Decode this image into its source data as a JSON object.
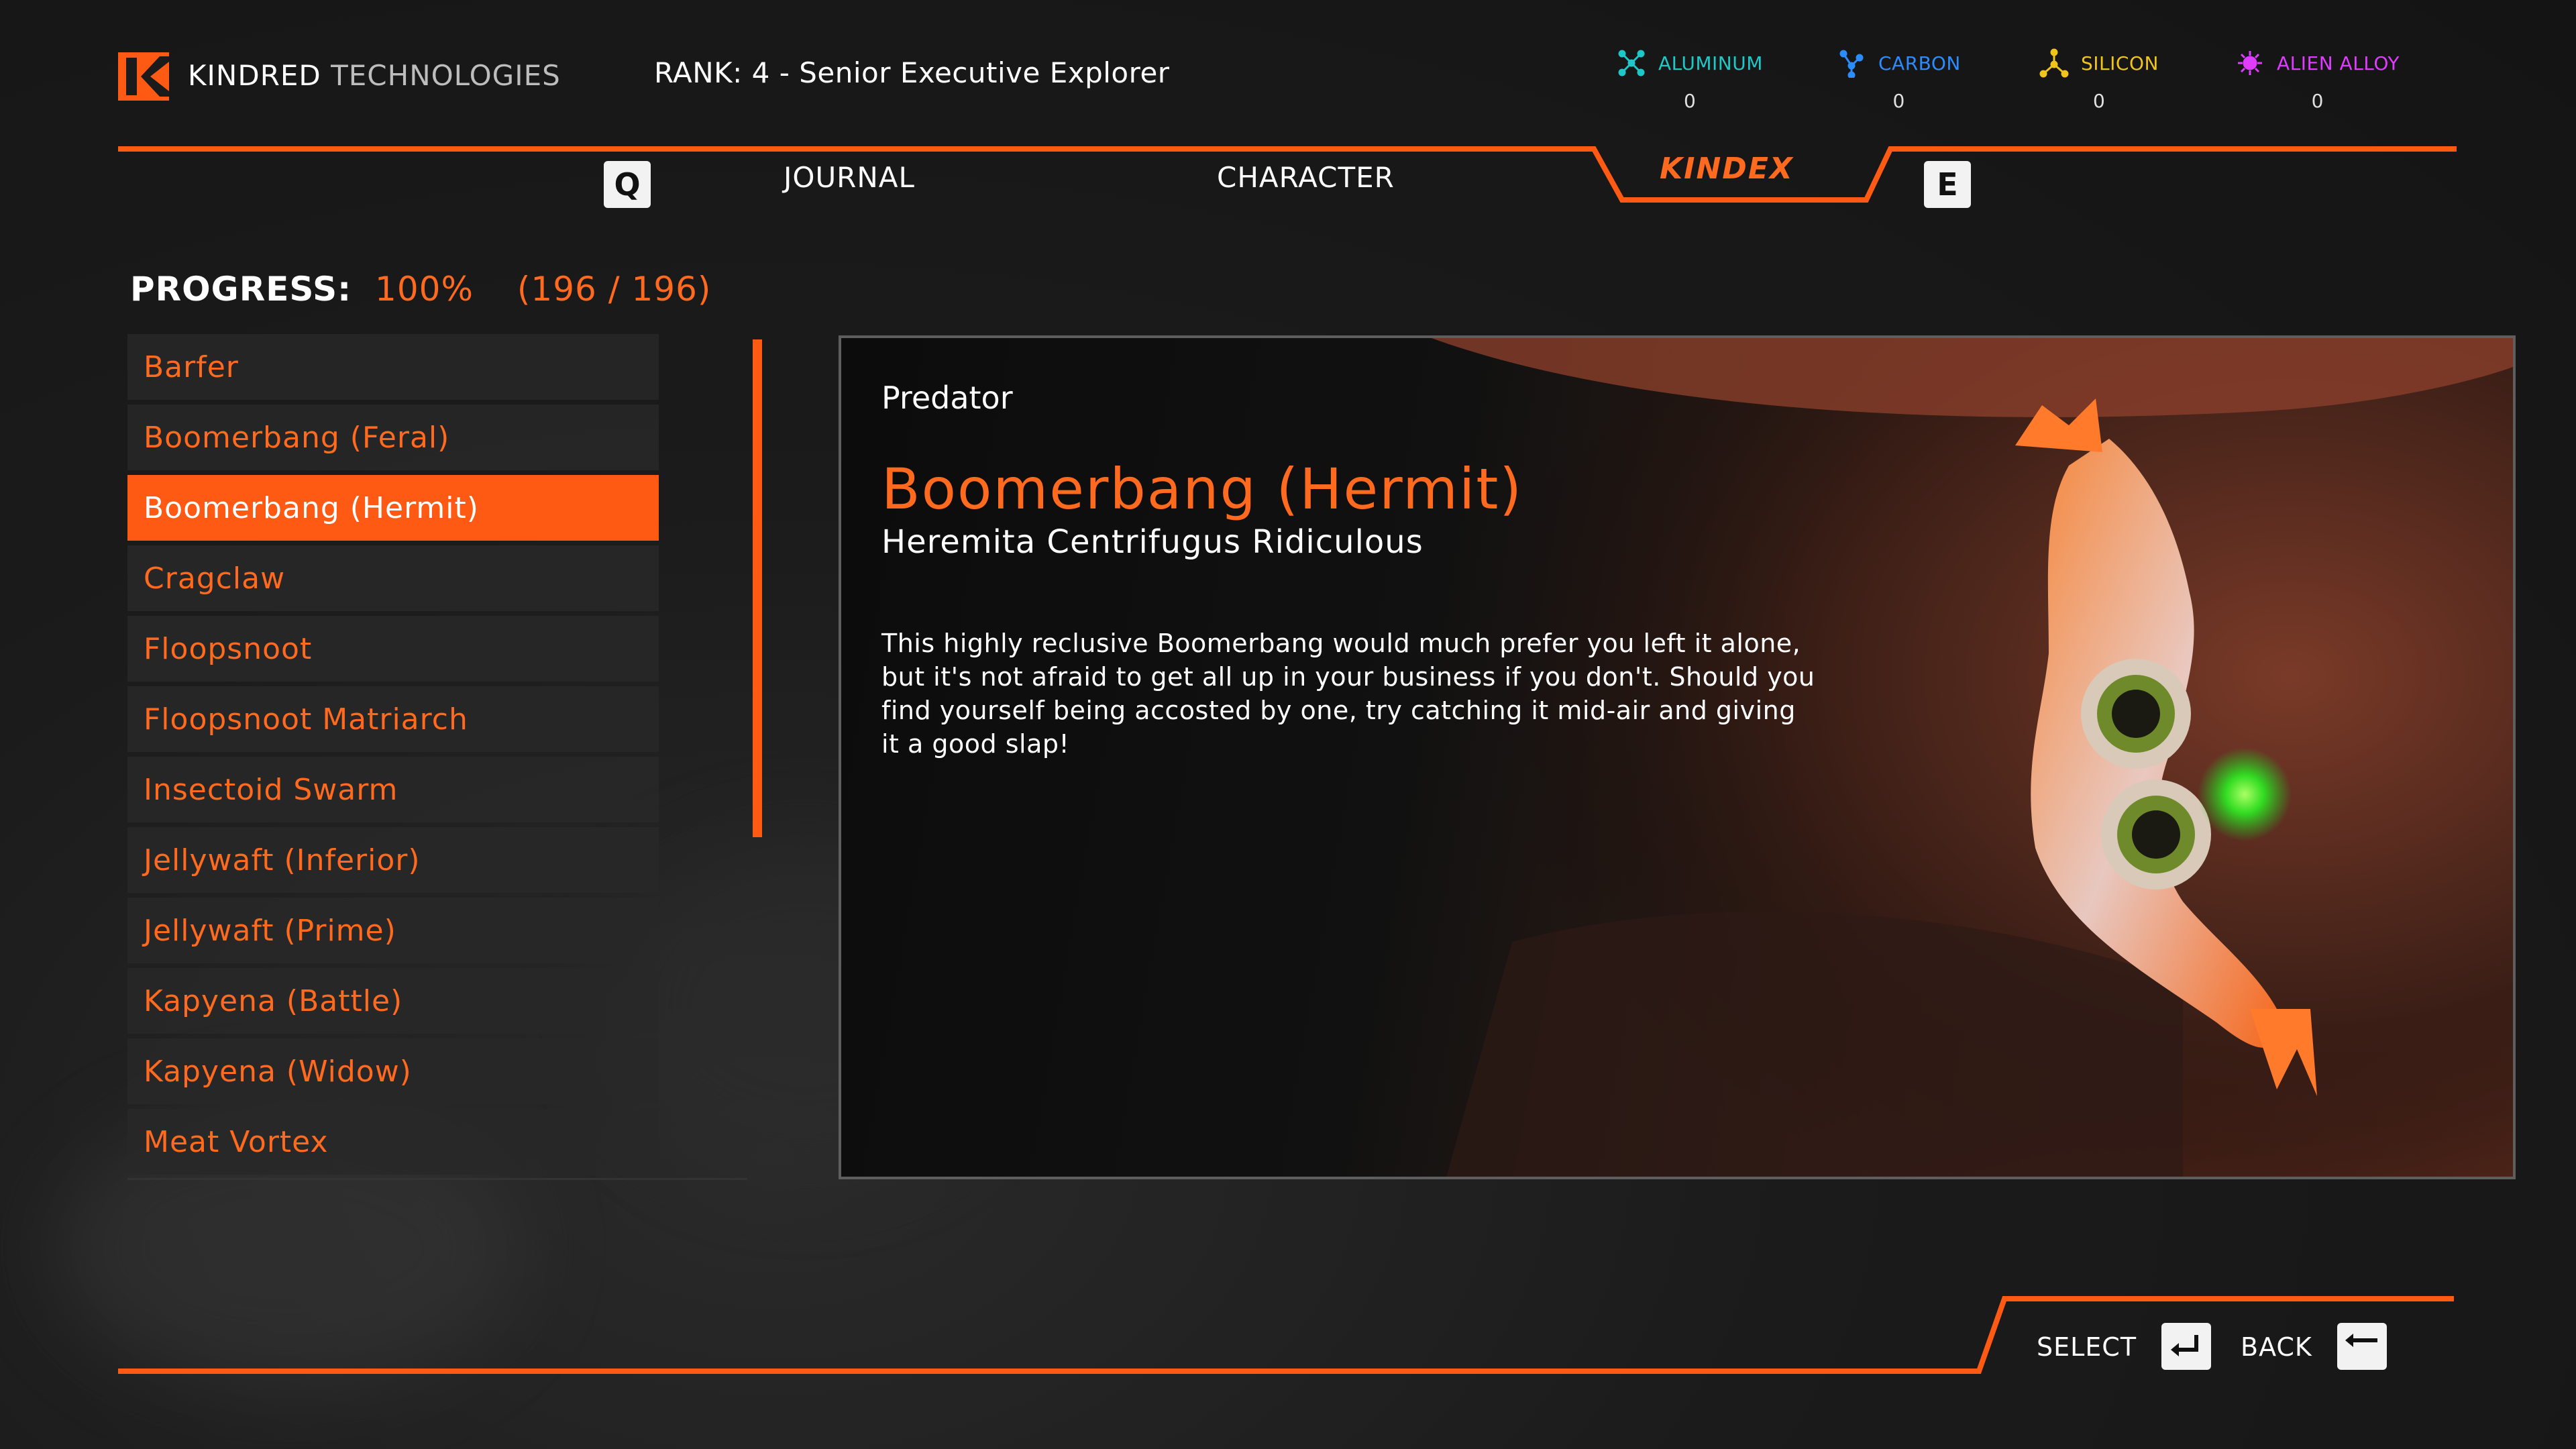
{
  "header": {
    "brand_primary": "KINDRED",
    "brand_secondary": "TECHNOLOGIES",
    "rank": "RANK: 4 - Senior Executive Explorer"
  },
  "resources": [
    {
      "label": "ALUMINUM",
      "value": "0",
      "color": "#1ec8c8",
      "icon": "aluminum-icon"
    },
    {
      "label": "CARBON",
      "value": "0",
      "color": "#2b8cff",
      "icon": "carbon-icon"
    },
    {
      "label": "SILICON",
      "value": "0",
      "color": "#f0c419",
      "icon": "silicon-icon"
    },
    {
      "label": "ALIEN ALLOY",
      "value": "0",
      "color": "#e03cff",
      "icon": "alien-alloy-icon"
    }
  ],
  "tabs": {
    "prev_key": "Q",
    "next_key": "E",
    "journal": "JOURNAL",
    "character": "CHARACTER",
    "kindex": "KINDEX"
  },
  "progress": {
    "label": "PROGRESS:",
    "percent": "100%",
    "count": "(196 / 196)"
  },
  "creature_list": [
    {
      "label": "Barfer"
    },
    {
      "label": "Boomerbang (Feral)"
    },
    {
      "label": "Boomerbang (Hermit)",
      "selected": true
    },
    {
      "label": "Cragclaw"
    },
    {
      "label": "Floopsnoot"
    },
    {
      "label": "Floopsnoot Matriarch"
    },
    {
      "label": "Insectoid Swarm"
    },
    {
      "label": "Jellywaft (Inferior)"
    },
    {
      "label": "Jellywaft (Prime)"
    },
    {
      "label": "Kapyena (Battle)"
    },
    {
      "label": "Kapyena (Widow)"
    },
    {
      "label": "Meat Vortex"
    }
  ],
  "detail": {
    "category": "Predator",
    "name": "Boomerbang (Hermit)",
    "scientific": "Heremita Centrifugus Ridiculous",
    "description": "This highly reclusive Boomerbang would much prefer you left it alone, but it's not afraid to get all up in your business if you don't. Should you find yourself being accosted by one, try catching it mid-air and giving it a good slap!"
  },
  "footer": {
    "select": "SELECT",
    "back": "BACK"
  },
  "colors": {
    "accent": "#ff5a14",
    "accent_text": "#ff6a1e"
  }
}
